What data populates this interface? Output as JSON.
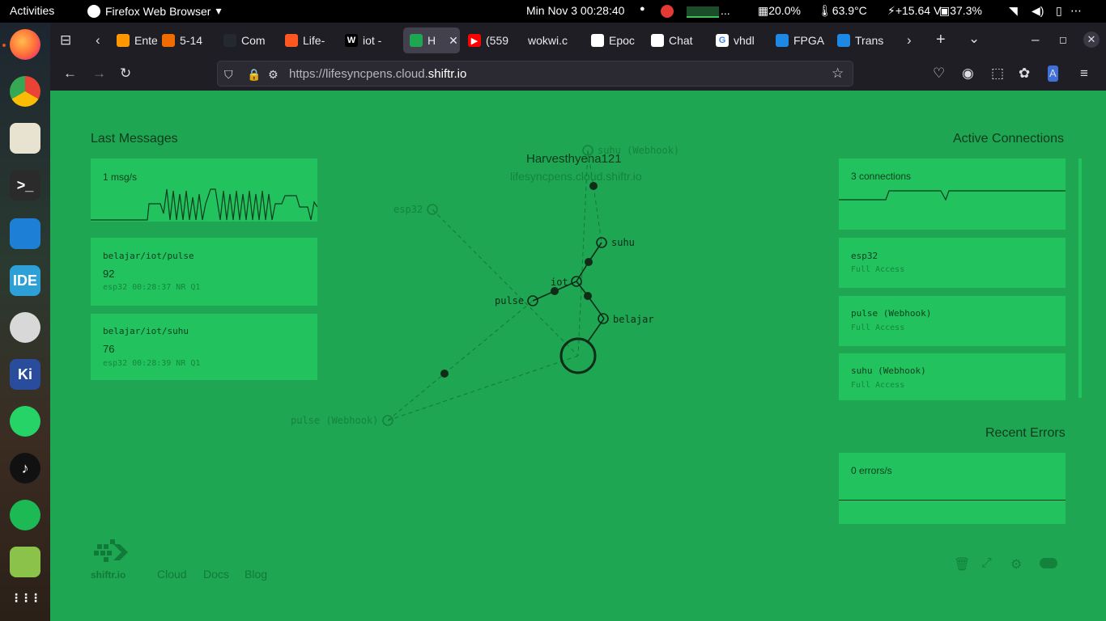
{
  "system_bar": {
    "activities": "Activities",
    "app_name": "Firefox Web Browser",
    "datetime": "Min Nov 3  00:28:40",
    "cpu": "20.0%",
    "temp": "63.9°C",
    "power": "+15.64 V",
    "disk": "37.3%",
    "ellipsis": "..."
  },
  "dock": {
    "items": [
      {
        "name": "firefox-icon",
        "color": "#ff7139",
        "glyph": ""
      },
      {
        "name": "chrome-icon",
        "color": "#4285f4",
        "glyph": ""
      },
      {
        "name": "files-icon",
        "color": "#e8e2d0",
        "glyph": ""
      },
      {
        "name": "terminal-icon",
        "color": "#2b2b2b",
        "glyph": ">_"
      },
      {
        "name": "vscode-icon",
        "color": "#1e7fd6",
        "glyph": ""
      },
      {
        "name": "arduino-ide-icon",
        "color": "#2ea0d8",
        "glyph": "IDE"
      },
      {
        "name": "settings-icon",
        "color": "#d8d8d8",
        "glyph": ""
      },
      {
        "name": "kicad-icon",
        "color": "#2a4c9c",
        "glyph": "Ki"
      },
      {
        "name": "whatsapp-icon",
        "color": "#25d366",
        "glyph": ""
      },
      {
        "name": "tiktok-icon",
        "color": "#111111",
        "glyph": "♪"
      },
      {
        "name": "spotify-icon",
        "color": "#1db954",
        "glyph": ""
      },
      {
        "name": "frog-app-icon",
        "color": "#8bc34a",
        "glyph": ""
      },
      {
        "name": "app-grid-icon",
        "color": "transparent",
        "glyph": "⋮⋮⋮"
      }
    ]
  },
  "tabs": [
    {
      "label": "Ente",
      "fav": "#ff9800",
      "fav_text": ""
    },
    {
      "label": "5-14",
      "fav": "#ef6c00",
      "fav_text": ""
    },
    {
      "label": "Com",
      "fav": "#24292f",
      "fav_text": ""
    },
    {
      "label": "Life-",
      "fav": "#ff5722",
      "fav_text": ""
    },
    {
      "label": "iot - ",
      "fav": "#000000",
      "fav_text": "W"
    },
    {
      "label": "H",
      "fav": "#1ea653",
      "fav_text": ""
    },
    {
      "label": "(559",
      "fav": "#ff0000",
      "fav_text": "▶"
    },
    {
      "label": "wokwi.c",
      "fav": "transparent",
      "fav_text": ""
    },
    {
      "label": "Epoc",
      "fav": "#ffffff",
      "fav_text": ""
    },
    {
      "label": "Chat",
      "fav": "#ffffff",
      "fav_text": ""
    },
    {
      "label": "vhdl",
      "fav": "#ffffff",
      "fav_text": "G"
    },
    {
      "label": "FPGA",
      "fav": "#1e88e5",
      "fav_text": ""
    },
    {
      "label": "Trans",
      "fav": "#1e88e5",
      "fav_text": ""
    }
  ],
  "url": {
    "prefix": "https://lifesyncpens.cloud.",
    "domain": "shiftr.io"
  },
  "page": {
    "last_messages_heading": "Last Messages",
    "active_connections_heading": "Active Connections",
    "recent_errors_heading": "Recent Errors",
    "msg_rate": "1 msg/s",
    "messages": [
      {
        "topic": "belajar/iot/pulse",
        "value": "92",
        "meta": "esp32 00:28:37 NR Q1"
      },
      {
        "topic": "belajar/iot/suhu",
        "value": "76",
        "meta": "esp32 00:28:39 NR Q1"
      }
    ],
    "connection_count": "3 connections",
    "connections": [
      {
        "name": "esp32",
        "access": "Full Access"
      },
      {
        "name": "pulse (Webhook)",
        "access": "Full Access"
      },
      {
        "name": "suhu (Webhook)",
        "access": "Full Access"
      }
    ],
    "error_rate": "0 errors/s",
    "instance_title": "Harvesthyena121",
    "instance_host": "lifesyncpens.cloud.shiftr.io",
    "footer": {
      "logo": "shiftr.io",
      "links": [
        "Cloud",
        "Docs",
        "Blog"
      ]
    }
  },
  "graph_labels": {
    "suhu_webhook": "suhu (Webhook)",
    "esp32": "esp32",
    "suhu": "suhu",
    "iot": "iot",
    "pulse": "pulse",
    "belajar": "belajar",
    "pulse_webhook": "pulse (Webhook)"
  }
}
